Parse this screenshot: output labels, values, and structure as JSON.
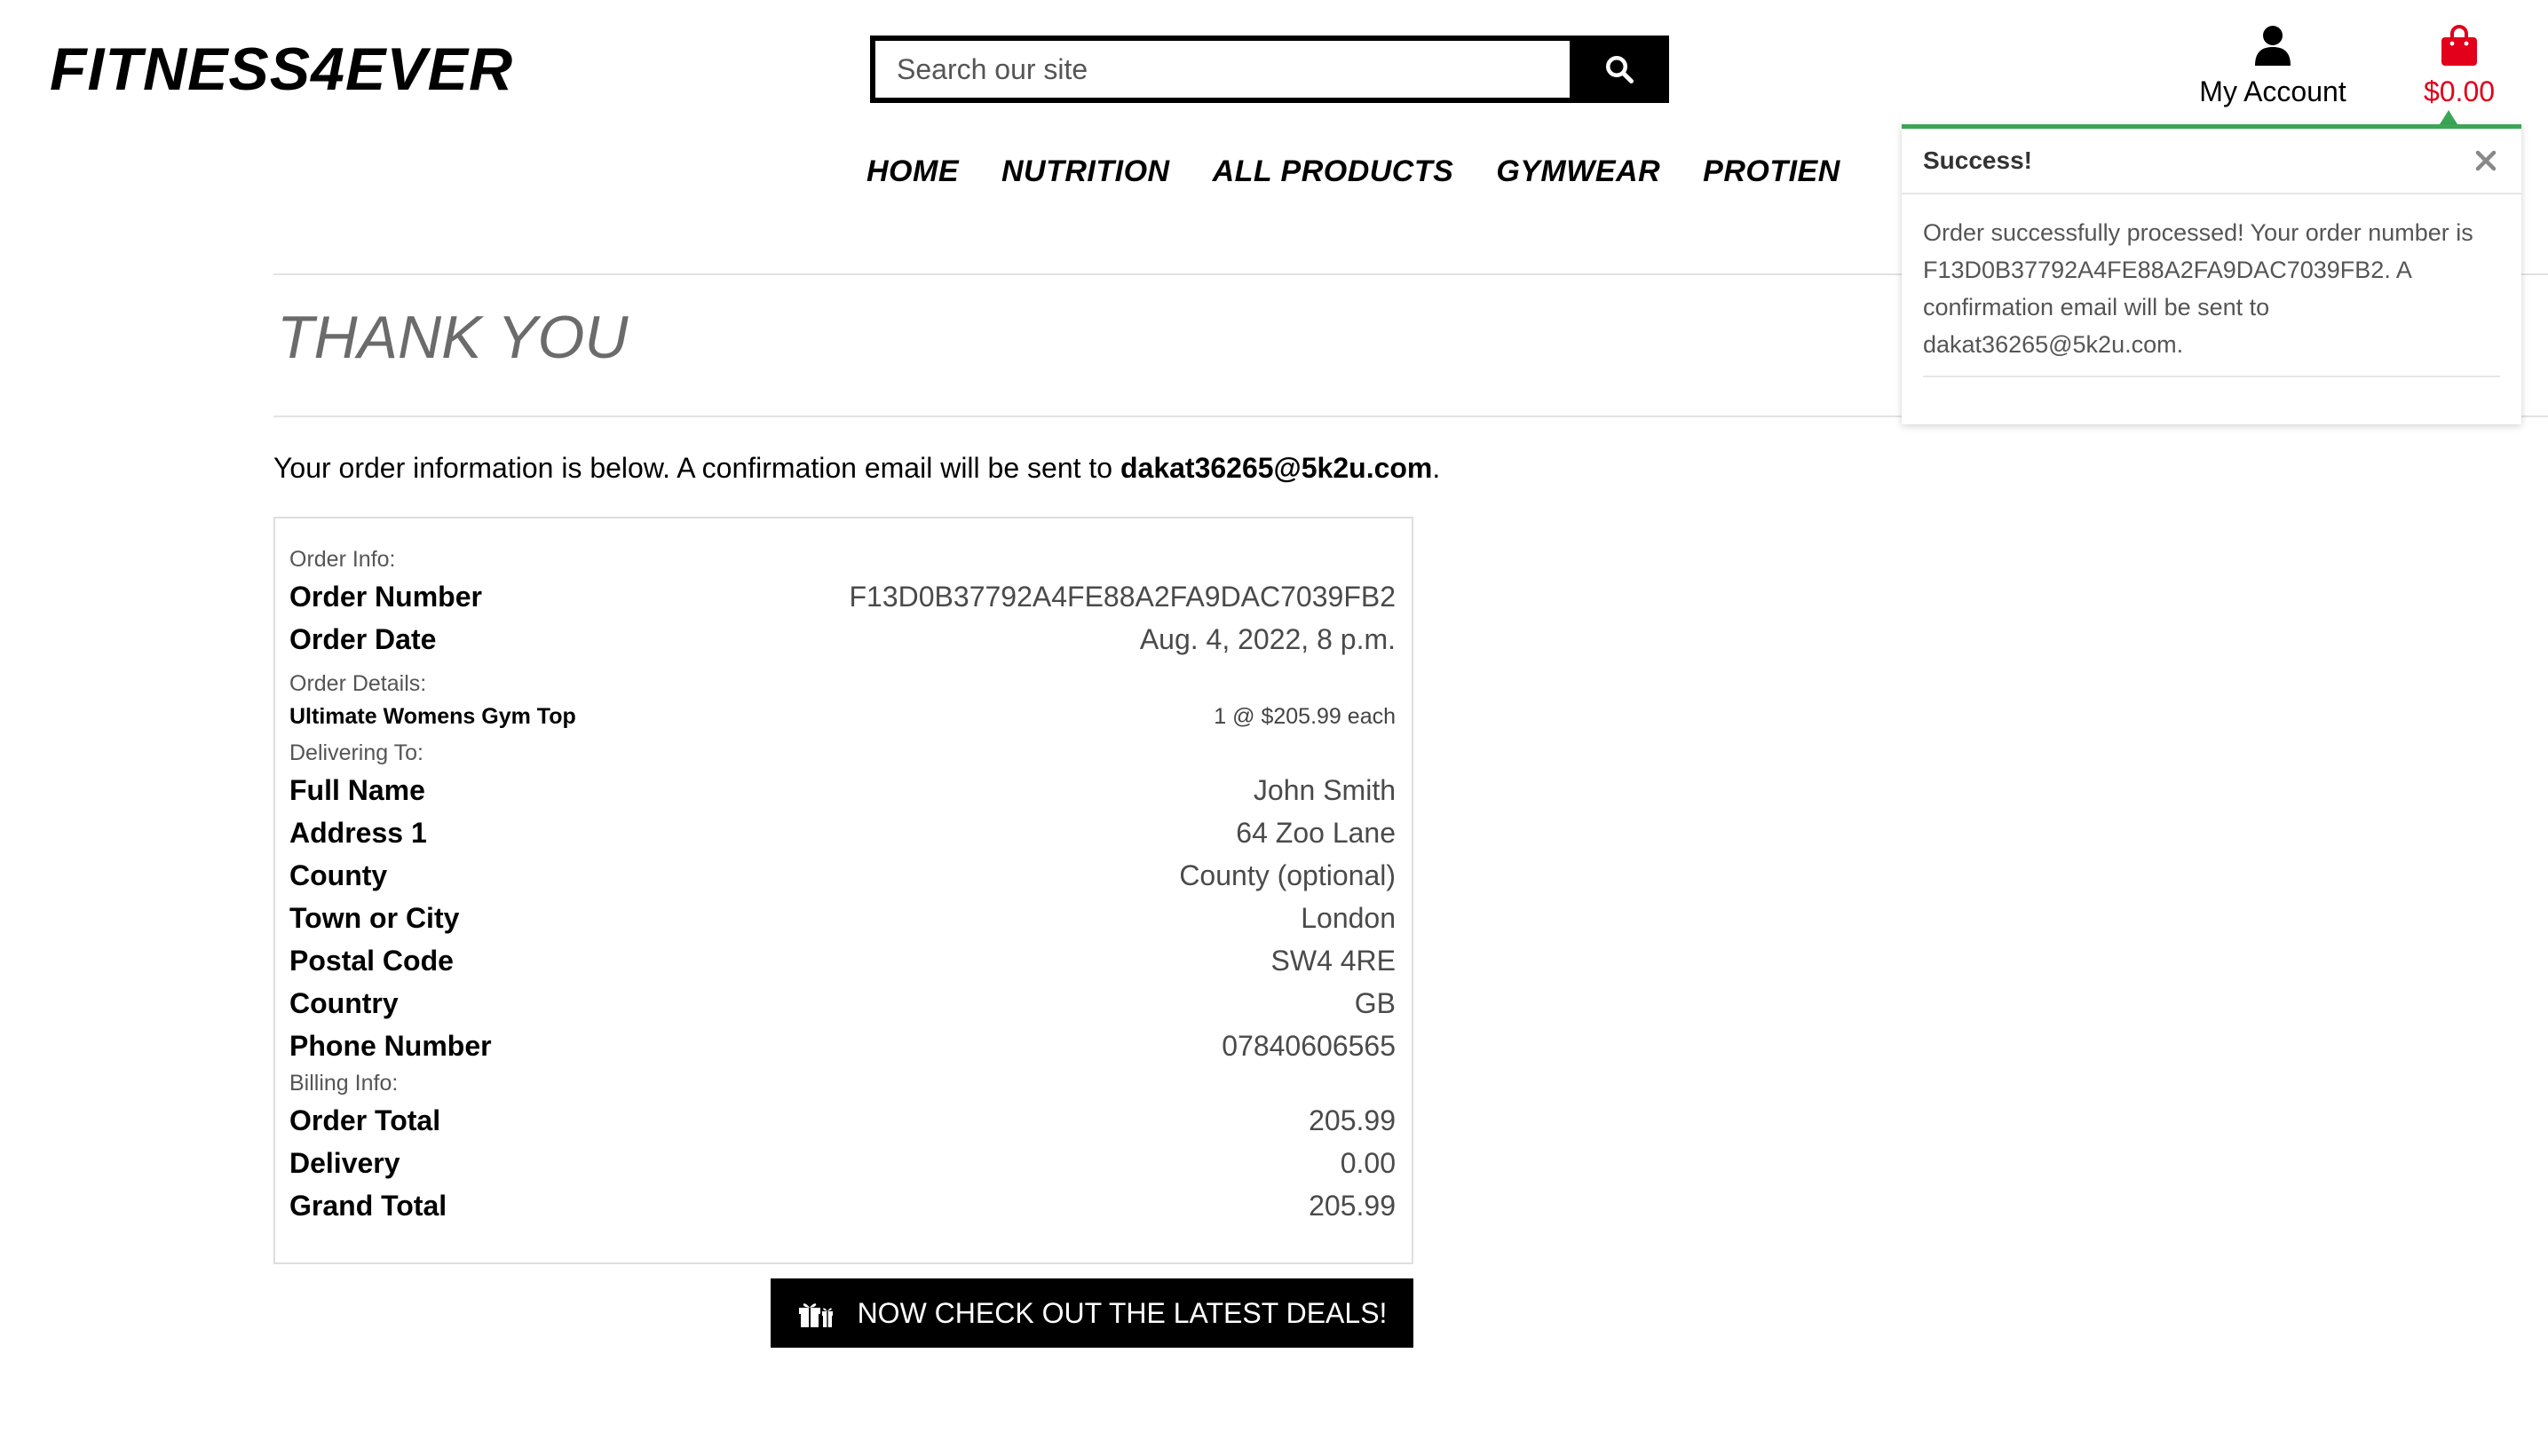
{
  "header": {
    "logo": "FITNESS4EVER",
    "search": {
      "placeholder": "Search our site",
      "value": ""
    },
    "account_label": "My Account",
    "cart_total": "$0.00"
  },
  "nav": {
    "items": [
      {
        "label": "HOME"
      },
      {
        "label": "NUTRITION"
      },
      {
        "label": "ALL PRODUCTS"
      },
      {
        "label": "GYMWEAR"
      },
      {
        "label": "PROTIEN"
      }
    ]
  },
  "main": {
    "title": "THANK YOU",
    "intro_prefix": "Your order information is below. A confirmation email will be sent to ",
    "intro_email": "dakat36265@5k2u.com",
    "intro_suffix": "."
  },
  "order": {
    "order_info_label": "Order Info:",
    "order_number_label": "Order Number",
    "order_number": "F13D0B37792A4FE88A2FA9DAC7039FB2",
    "order_date_label": "Order Date",
    "order_date": "Aug. 4, 2022, 8 p.m.",
    "order_details_label": "Order Details:",
    "items": [
      {
        "name": "Ultimate Womens Gym Top",
        "qty_price": "1 @ $205.99 each"
      }
    ],
    "delivering_label": "Delivering To:",
    "delivery": [
      {
        "label": "Full Name",
        "value": "John Smith"
      },
      {
        "label": "Address 1",
        "value": "64 Zoo Lane"
      },
      {
        "label": "County",
        "value": "County (optional)"
      },
      {
        "label": "Town or City",
        "value": "London"
      },
      {
        "label": "Postal Code",
        "value": "SW4 4RE"
      },
      {
        "label": "Country",
        "value": "GB"
      },
      {
        "label": "Phone Number",
        "value": "07840606565"
      }
    ],
    "billing_label": "Billing Info:",
    "billing": [
      {
        "label": "Order Total",
        "value": "205.99"
      },
      {
        "label": "Delivery",
        "value": "0.00"
      },
      {
        "label": "Grand Total",
        "value": "205.99"
      }
    ]
  },
  "deals_button": {
    "label": "NOW CHECK OUT THE LATEST DEALS!"
  },
  "toast": {
    "title": "Success!",
    "message": "Order successfully processed! Your order number is F13D0B37792A4FE88A2FA9DAC7039FB2. A confirmation email will be sent to dakat36265@5k2u.com."
  },
  "colors": {
    "accent_success": "#3aa655",
    "cart_red": "#e2001a",
    "title_grey": "#6b6b6b"
  },
  "icons": {
    "search": "search-icon",
    "account": "user-icon",
    "cart": "shopping-bag-icon",
    "deals": "gift-icon",
    "close": "close-icon"
  }
}
